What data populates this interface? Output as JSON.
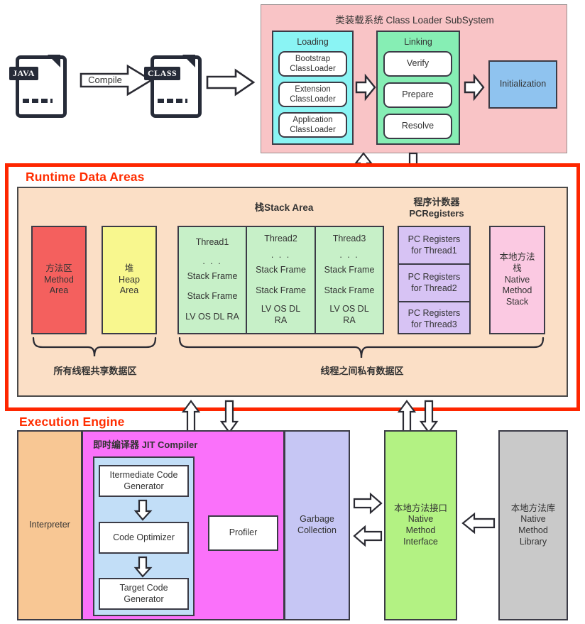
{
  "pipeline": {
    "java_file_label": "JAVA",
    "class_file_label": "CLASS",
    "compile_label": "Compile"
  },
  "class_loader": {
    "title": "类装载系统 Class Loader SubSystem",
    "loading": {
      "title": "Loading",
      "items": [
        "Bootstrap\nClassLoader",
        "Extension\nClassLoader",
        "Application\nClassLoader"
      ]
    },
    "linking": {
      "title": "Linking",
      "items": [
        "Verify",
        "Prepare",
        "Resolve"
      ]
    },
    "initialization": "Initialization"
  },
  "runtime_data_areas": {
    "section_label": "Runtime Data Areas",
    "stack_area_title": "栈Stack Area",
    "pc_registers_title": "程序计数器\nPCRegisters",
    "method_area": "方法区\nMethod\nArea",
    "heap_area": "堆\nHeap\nArea",
    "threads": [
      {
        "name": "Thread1",
        "ellipsis": ". . .",
        "frames": [
          "Stack Frame",
          "Stack Frame"
        ],
        "slots": "LV OS DL RA"
      },
      {
        "name": "Thread2",
        "ellipsis": ". . .",
        "frames": [
          "Stack Frame",
          "Stack Frame"
        ],
        "slots": "LV OS DL\nRA"
      },
      {
        "name": "Thread3",
        "ellipsis": ". . .",
        "frames": [
          "Stack Frame",
          "Stack Frame"
        ],
        "slots": "LV OS DL\nRA"
      }
    ],
    "pc_registers": [
      "PC Registers\nfor Thread1",
      "PC Registers\nfor Thread2",
      "PC Registers\nfor Thread3"
    ],
    "native_method_stack": "本地方法\n栈\nNative\nMethod\nStack",
    "shared_brace_label": "所有线程共享数据区",
    "private_brace_label": "线程之间私有数据区"
  },
  "execution_engine": {
    "section_label": "Execution Engine",
    "interpreter": "Interpreter",
    "jit_title": "即时编译器 JIT Compiler",
    "jit_stages": [
      "Itermediate Code\nGenerator",
      "Code Optimizer",
      "Target Code\nGenerator"
    ],
    "profiler": "Profiler",
    "garbage_collection": "Garbage\nCollection",
    "native_method_interface": "本地方法接口\nNative\nMethod\nInterface",
    "native_method_library": "本地方法库\nNative\nMethod\nLibrary"
  },
  "colors": {
    "section_red": "#fe2600",
    "class_loader_bg": "#f9c4c6",
    "loading_bg": "#8af4f4",
    "linking_bg": "#86eeb4",
    "initialization_bg": "#8fc3ef",
    "runtime_bg": "#fbdfc6",
    "method_area_bg": "#f4605e",
    "heap_bg": "#f8f78e",
    "thread_bg": "#c7f0c8",
    "pc_registers_bg": "#d7c3f4",
    "native_method_stack_bg": "#fbc9e2",
    "interpreter_bg": "#f8c794",
    "jit_bg": "#fa71fa",
    "jit_inner_bg": "#c2def7",
    "gc_bg": "#c6c6f4",
    "nmi_bg": "#b3f283",
    "nml_bg": "#c9c9c9"
  }
}
